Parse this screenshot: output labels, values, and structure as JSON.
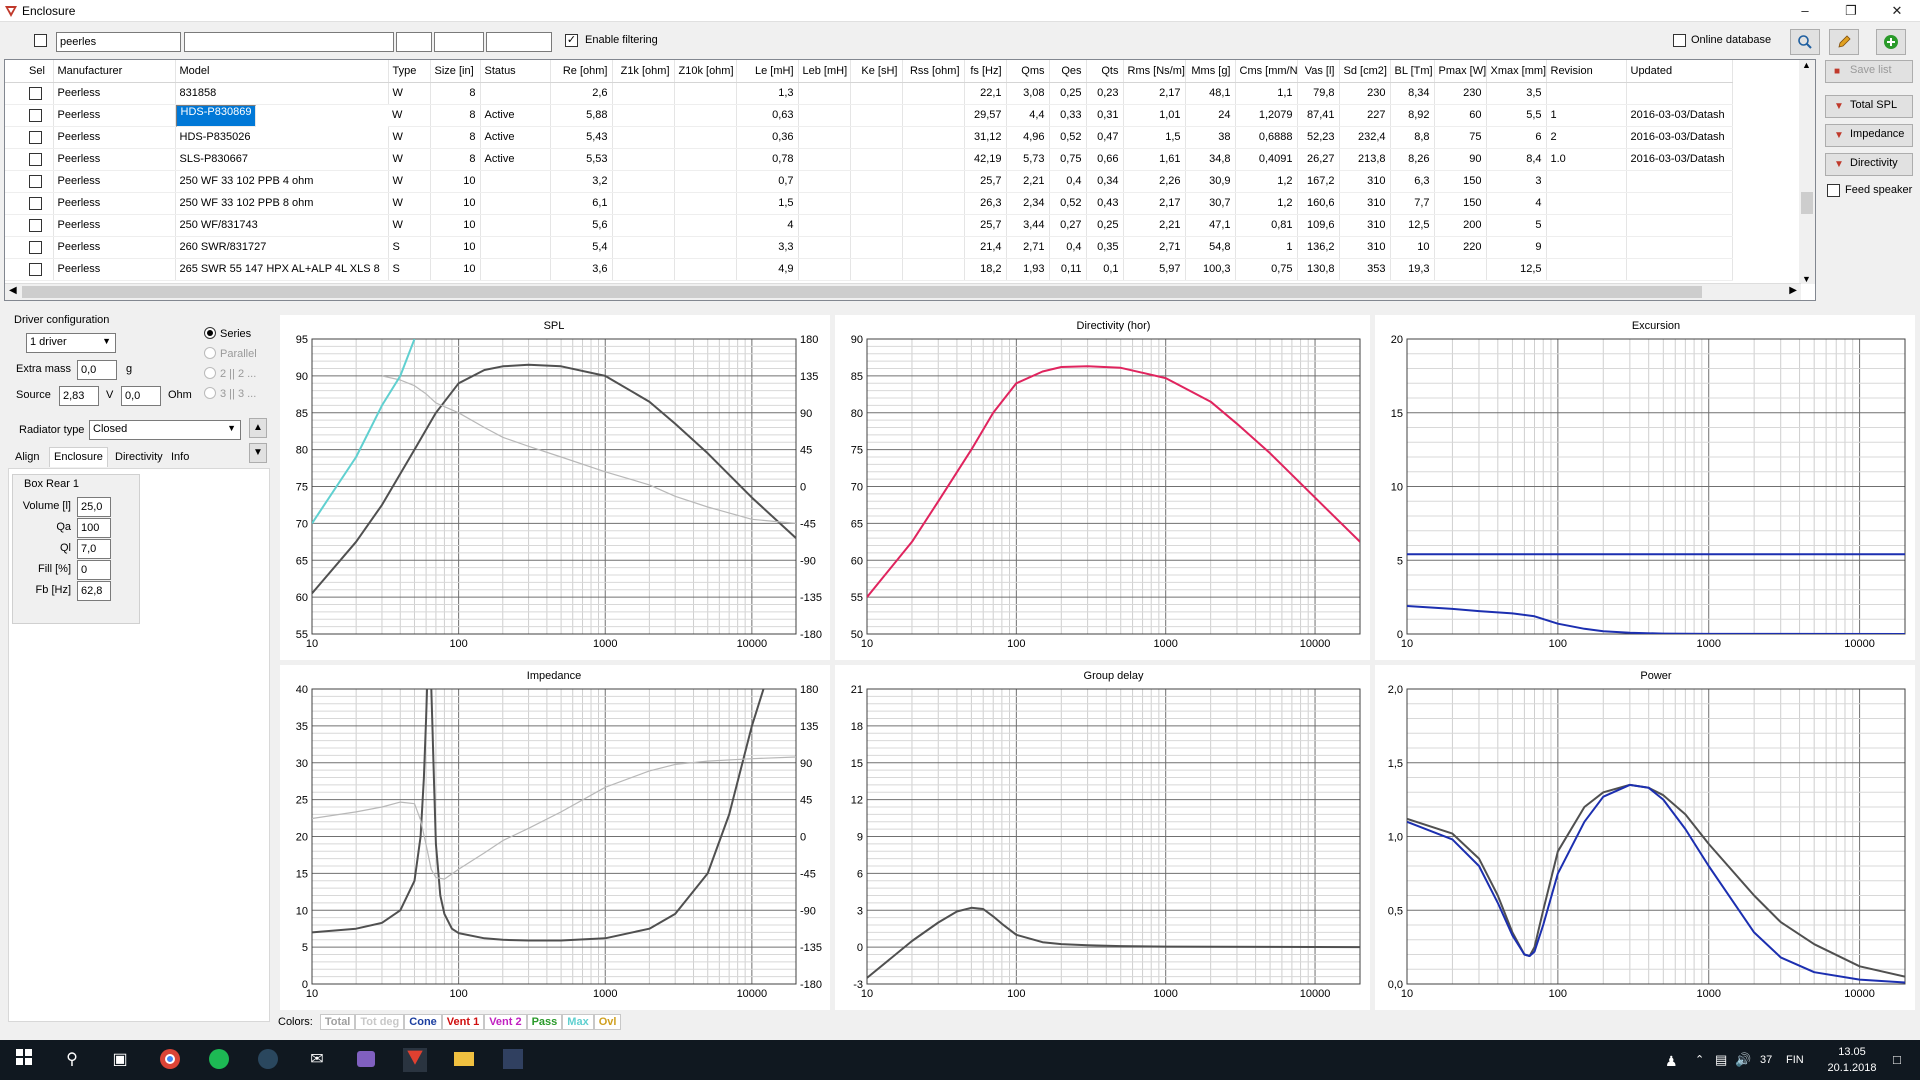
{
  "window": {
    "title": "Enclosure"
  },
  "filter": {
    "search_value": "peerles",
    "enable_filtering": "Enable filtering",
    "online_database": "Online database"
  },
  "grid": {
    "columns": [
      "Sel",
      "Manufacturer",
      "Model",
      "Type",
      "Size [in]",
      "Status",
      "Re [ohm]",
      "Z1k [ohm]",
      "Z10k [ohm]",
      "Le [mH]",
      "Leb [mH]",
      "Ke [sH]",
      "Rss [ohm]",
      "fs [Hz]",
      "Qms",
      "Qes",
      "Qts",
      "Rms [Ns/m]",
      "Mms [g]",
      "Cms [mm/N]",
      "Vas [l]",
      "Sd [cm2]",
      "BL [Tm]",
      "Pmax [W]",
      "Xmax [mm]",
      "Revision",
      "Updated"
    ],
    "rows": [
      [
        "",
        "Peerless",
        "831858",
        "W",
        "8",
        "",
        "2,6",
        "",
        "",
        "1,3",
        "",
        "",
        "",
        "22,1",
        "3,08",
        "0,25",
        "0,23",
        "2,17",
        "48,1",
        "1,1",
        "79,8",
        "230",
        "8,34",
        "230",
        "3,5",
        "",
        ""
      ],
      [
        "",
        "Peerless",
        "HDS-P830869",
        "W",
        "8",
        "Active",
        "5,88",
        "",
        "",
        "0,63",
        "",
        "",
        "",
        "29,57",
        "4,4",
        "0,33",
        "0,31",
        "1,01",
        "24",
        "1,2079",
        "87,41",
        "227",
        "8,92",
        "60",
        "5,5",
        "1",
        "2016-03-03/Datash"
      ],
      [
        "",
        "Peerless",
        "HDS-P835026",
        "W",
        "8",
        "Active",
        "5,43",
        "",
        "",
        "0,36",
        "",
        "",
        "",
        "31,12",
        "4,96",
        "0,52",
        "0,47",
        "1,5",
        "38",
        "0,6888",
        "52,23",
        "232,4",
        "8,8",
        "75",
        "6",
        "2",
        "2016-03-03/Datash"
      ],
      [
        "",
        "Peerless",
        "SLS-P830667",
        "W",
        "8",
        "Active",
        "5,53",
        "",
        "",
        "0,78",
        "",
        "",
        "",
        "42,19",
        "5,73",
        "0,75",
        "0,66",
        "1,61",
        "34,8",
        "0,4091",
        "26,27",
        "213,8",
        "8,26",
        "90",
        "8,4",
        "1.0",
        "2016-03-03/Datash"
      ],
      [
        "",
        "Peerless",
        "250 WF 33 102 PPB 4 ohm",
        "W",
        "10",
        "",
        "3,2",
        "",
        "",
        "0,7",
        "",
        "",
        "",
        "25,7",
        "2,21",
        "0,4",
        "0,34",
        "2,26",
        "30,9",
        "1,2",
        "167,2",
        "310",
        "6,3",
        "150",
        "3",
        "",
        ""
      ],
      [
        "",
        "Peerless",
        "250 WF 33 102 PPB 8 ohm",
        "W",
        "10",
        "",
        "6,1",
        "",
        "",
        "1,5",
        "",
        "",
        "",
        "26,3",
        "2,34",
        "0,52",
        "0,43",
        "2,17",
        "30,7",
        "1,2",
        "160,6",
        "310",
        "7,7",
        "150",
        "4",
        "",
        ""
      ],
      [
        "",
        "Peerless",
        "250 WF/831743",
        "W",
        "10",
        "",
        "5,6",
        "",
        "",
        "4",
        "",
        "",
        "",
        "25,7",
        "3,44",
        "0,27",
        "0,25",
        "2,21",
        "47,1",
        "0,81",
        "109,6",
        "310",
        "12,5",
        "200",
        "5",
        "",
        ""
      ],
      [
        "",
        "Peerless",
        "260 SWR/831727",
        "S",
        "10",
        "",
        "5,4",
        "",
        "",
        "3,3",
        "",
        "",
        "",
        "21,4",
        "2,71",
        "0,4",
        "0,35",
        "2,71",
        "54,8",
        "1",
        "136,2",
        "310",
        "10",
        "220",
        "9",
        "",
        ""
      ],
      [
        "",
        "Peerless",
        "265 SWR 55 147 HPX AL+ALP 4L XLS 8",
        "S",
        "10",
        "",
        "3,6",
        "",
        "",
        "4,9",
        "",
        "",
        "",
        "18,2",
        "1,93",
        "0,11",
        "0,1",
        "5,97",
        "100,3",
        "0,75",
        "130,8",
        "353",
        "19,3",
        "",
        "12,5",
        "",
        ""
      ]
    ]
  },
  "side_buttons": {
    "save_list": "Save list",
    "total_spl": "Total SPL",
    "impedance": "Impedance",
    "directivity": "Directivity",
    "feed_speaker": "Feed speaker"
  },
  "left": {
    "driver_configuration": "Driver configuration",
    "driver_count": "1 driver",
    "extra_mass_label": "Extra mass",
    "extra_mass": "0,0",
    "g": "g",
    "source_label": "Source",
    "source_v": "2,83",
    "v": "V",
    "source_ohm": "0,0",
    "ohm": "Ohm",
    "series": "Series",
    "parallel": "Parallel",
    "r22": "2 || 2 ...",
    "r33": "3 || 3 ...",
    "radiator_type_label": "Radiator type",
    "radiator_type": "Closed",
    "tabs": [
      "Align",
      "Enclosure",
      "Directivity",
      "Info"
    ],
    "box_rear": "Box Rear 1",
    "params": [
      {
        "label": "Volume [l]",
        "value": "25,0"
      },
      {
        "label": "Qa",
        "value": "100"
      },
      {
        "label": "Ql",
        "value": "7,0"
      },
      {
        "label": "Fill [%]",
        "value": "0"
      },
      {
        "label": "Fb [Hz]",
        "value": "62,8"
      }
    ]
  },
  "colors": {
    "label": "Colors:",
    "items": [
      {
        "name": "Total",
        "color": "#a0a0a0"
      },
      {
        "name": "Tot deg",
        "color": "#c8c8c8"
      },
      {
        "name": "Cone",
        "color": "#1c3fa0"
      },
      {
        "name": "Vent 1",
        "color": "#d01010"
      },
      {
        "name": "Vent 2",
        "color": "#c020c0"
      },
      {
        "name": "Pass",
        "color": "#2a9a2a"
      },
      {
        "name": "Max",
        "color": "#60d0d0"
      },
      {
        "name": "Ovl",
        "color": "#d0a020"
      }
    ]
  },
  "chart_data": [
    {
      "type": "line",
      "title": "SPL",
      "xscale": "log",
      "xlim": [
        10,
        20000
      ],
      "xticks": [
        "10",
        "100",
        "1000",
        "10000"
      ],
      "ylim": [
        55,
        95
      ],
      "yticks": [
        "95",
        "90",
        "85",
        "80",
        "75",
        "70",
        "65",
        "60",
        "55"
      ],
      "y2lim": [
        -180,
        180
      ],
      "y2ticks": [
        "180",
        "135",
        "90",
        "45",
        "0",
        "-45",
        "-90",
        "-135",
        "-180"
      ],
      "series": [
        {
          "color": "#505050",
          "axis": "left",
          "x": [
            10,
            20,
            30,
            50,
            70,
            100,
            150,
            200,
            300,
            500,
            1000,
            2000,
            3000,
            5000,
            10000,
            20000
          ],
          "y": [
            60.5,
            67.5,
            72.5,
            80,
            85,
            89,
            90.8,
            91.3,
            91.5,
            91.3,
            90,
            86.5,
            83.5,
            79.5,
            73.5,
            68
          ]
        },
        {
          "color": "#b8b8b8",
          "axis": "right",
          "x": [
            30,
            40,
            50,
            60,
            70,
            100,
            150,
            200,
            300,
            500,
            1000,
            2000,
            3000,
            5000,
            10000,
            20000
          ],
          "y": [
            135,
            130,
            123,
            113,
            102,
            90,
            72,
            60,
            49,
            36,
            18,
            2,
            -12,
            -25,
            -40,
            -45
          ]
        },
        {
          "color": "#60d0d0",
          "axis": "left",
          "x": [
            10,
            20,
            30,
            40,
            50
          ],
          "y": [
            70,
            79,
            86,
            90,
            95
          ]
        }
      ]
    },
    {
      "type": "line",
      "title": "Directivity (hor)",
      "xscale": "log",
      "xlim": [
        10,
        20000
      ],
      "xticks": [
        "10",
        "100",
        "1000",
        "10000"
      ],
      "ylim": [
        50,
        90
      ],
      "yticks": [
        "90",
        "85",
        "80",
        "75",
        "70",
        "65",
        "60",
        "55",
        "50"
      ],
      "series": [
        {
          "color": "#e0245e",
          "axis": "left",
          "x": [
            10,
            20,
            30,
            50,
            70,
            100,
            150,
            200,
            300,
            500,
            1000,
            2000,
            3000,
            5000,
            10000,
            20000
          ],
          "y": [
            55,
            62.5,
            68,
            75,
            80,
            84,
            85.6,
            86.2,
            86.3,
            86.1,
            84.7,
            81.5,
            78.5,
            74.5,
            68.5,
            62.5
          ]
        }
      ]
    },
    {
      "type": "line",
      "title": "Excursion",
      "xscale": "log",
      "xlim": [
        10,
        20000
      ],
      "xticks": [
        "10",
        "100",
        "1000",
        "10000"
      ],
      "ylim": [
        0,
        20
      ],
      "yticks": [
        "20",
        "15",
        "10",
        "5",
        "0"
      ],
      "series": [
        {
          "color": "#1c2fb0",
          "axis": "left",
          "x": [
            10,
            20,
            30,
            50,
            70,
            100,
            150,
            200,
            300,
            500,
            1000,
            20000
          ],
          "y": [
            1.9,
            1.7,
            1.55,
            1.4,
            1.2,
            0.7,
            0.35,
            0.18,
            0.08,
            0.03,
            0.01,
            0
          ]
        },
        {
          "color": "#1c2fb0",
          "axis": "left",
          "x": [
            10,
            20000
          ],
          "y": [
            5.4,
            5.4
          ]
        }
      ]
    },
    {
      "type": "line",
      "title": "Impedance",
      "xscale": "log",
      "xlim": [
        10,
        20000
      ],
      "xticks": [
        "10",
        "100",
        "1000",
        "10000"
      ],
      "ylim": [
        0,
        40
      ],
      "yticks": [
        "40",
        "35",
        "30",
        "25",
        "20",
        "15",
        "10",
        "5",
        "0"
      ],
      "y2lim": [
        -180,
        180
      ],
      "y2ticks": [
        "180",
        "135",
        "90",
        "45",
        "0",
        "-45",
        "-90",
        "-135",
        "-180"
      ],
      "series": [
        {
          "color": "#505050",
          "axis": "left",
          "x": [
            10,
            20,
            30,
            40,
            50,
            55,
            58,
            60,
            62,
            64,
            66,
            68,
            70,
            75,
            80,
            90,
            100,
            150,
            200,
            300,
            500,
            1000,
            2000,
            3000,
            5000,
            7000,
            10000,
            12000
          ],
          "y": [
            7,
            7.5,
            8.3,
            10,
            14,
            20,
            28,
            36,
            45,
            45,
            36,
            27,
            19,
            12,
            9.5,
            7.5,
            6.9,
            6.2,
            6,
            5.9,
            5.9,
            6.2,
            7.5,
            9.5,
            15,
            23,
            35,
            40
          ]
        },
        {
          "color": "#b8b8b8",
          "axis": "right",
          "x": [
            10,
            20,
            30,
            40,
            50,
            55,
            60,
            65,
            70,
            80,
            100,
            150,
            200,
            300,
            500,
            1000,
            2000,
            3000,
            5000,
            10000,
            20000
          ],
          "y": [
            22,
            30,
            36,
            42,
            40,
            20,
            -10,
            -40,
            -50,
            -52,
            -40,
            -20,
            -5,
            10,
            30,
            60,
            80,
            88,
            92,
            95,
            97
          ]
        }
      ]
    },
    {
      "type": "line",
      "title": "Group delay",
      "xscale": "log",
      "xlim": [
        10,
        20000
      ],
      "xticks": [
        "10",
        "100",
        "1000",
        "10000"
      ],
      "ylim": [
        -3,
        21
      ],
      "yticks": [
        "21",
        "18",
        "15",
        "12",
        "9",
        "6",
        "3",
        "0",
        "-3"
      ],
      "series": [
        {
          "color": "#505050",
          "axis": "left",
          "x": [
            10,
            20,
            30,
            40,
            50,
            60,
            70,
            80,
            100,
            150,
            200,
            300,
            500,
            1000,
            20000
          ],
          "y": [
            -2.5,
            0.5,
            2,
            2.9,
            3.2,
            3.1,
            2.5,
            1.9,
            1,
            0.4,
            0.25,
            0.15,
            0.08,
            0.04,
            0
          ]
        }
      ]
    },
    {
      "type": "line",
      "title": "Power",
      "xscale": "log",
      "xlim": [
        10,
        20000
      ],
      "xticks": [
        "10",
        "100",
        "1000",
        "10000"
      ],
      "ylim": [
        0,
        2
      ],
      "ytickvals": [
        2,
        1.5,
        1,
        0.5,
        0
      ],
      "yticks": [
        "2,0",
        "1,5",
        "1,0",
        "0,5",
        "0,0"
      ],
      "series": [
        {
          "color": "#505050",
          "axis": "left",
          "x": [
            10,
            20,
            30,
            40,
            50,
            60,
            65,
            70,
            80,
            100,
            150,
            200,
            300,
            400,
            500,
            700,
            1000,
            2000,
            3000,
            5000,
            10000,
            20000
          ],
          "y": [
            1.12,
            1.02,
            0.85,
            0.6,
            0.35,
            0.2,
            0.19,
            0.25,
            0.5,
            0.9,
            1.2,
            1.3,
            1.35,
            1.33,
            1.28,
            1.15,
            0.95,
            0.6,
            0.42,
            0.27,
            0.12,
            0.05
          ]
        },
        {
          "color": "#1c2fb0",
          "axis": "left",
          "x": [
            10,
            20,
            30,
            40,
            50,
            60,
            65,
            70,
            80,
            100,
            150,
            200,
            300,
            400,
            500,
            700,
            1000,
            2000,
            3000,
            5000,
            10000,
            20000
          ],
          "y": [
            1.1,
            0.98,
            0.8,
            0.55,
            0.33,
            0.2,
            0.19,
            0.22,
            0.4,
            0.75,
            1.1,
            1.27,
            1.35,
            1.33,
            1.25,
            1.05,
            0.8,
            0.35,
            0.18,
            0.08,
            0.03,
            0.01
          ]
        }
      ]
    }
  ],
  "taskbar": {
    "lang": "FIN",
    "time": "13.05",
    "date": "20.1.2018",
    "battery": "37"
  }
}
